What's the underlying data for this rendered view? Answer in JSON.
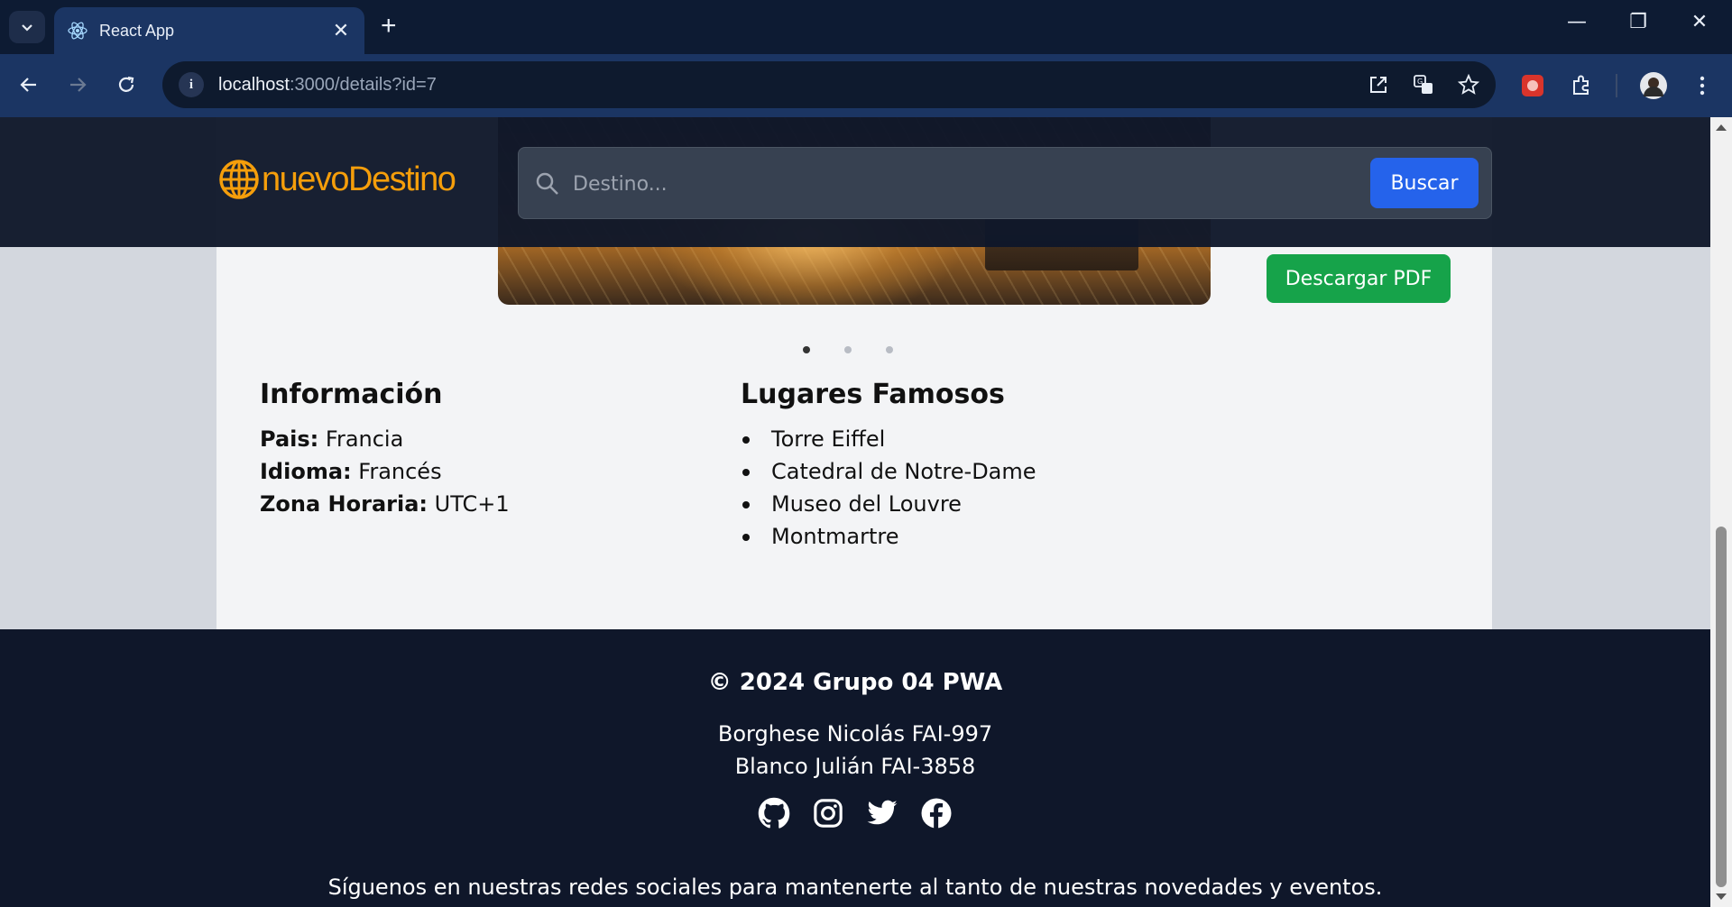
{
  "browser": {
    "tab_title": "React App",
    "url_host": "localhost",
    "url_path": ":3000/details?id=7"
  },
  "header": {
    "logo_text": "nuevoDestino",
    "search_placeholder": "Destino...",
    "search_button": "Buscar"
  },
  "carousel": {
    "slide_count": 3,
    "active_index": 0
  },
  "info": {
    "title": "Información",
    "rows": [
      {
        "label": "Pais:",
        "value": "Francia"
      },
      {
        "label": "Idioma:",
        "value": "Francés"
      },
      {
        "label": "Zona Horaria:",
        "value": "UTC+1"
      }
    ]
  },
  "places": {
    "title": "Lugares Famosos",
    "items": [
      "Torre Eiffel",
      "Catedral de Notre-Dame",
      "Museo del Louvre",
      "Montmartre"
    ]
  },
  "actions": {
    "pdf_button": "Descargar PDF"
  },
  "footer": {
    "copyright": "© 2024 Grupo 04 PWA",
    "members": [
      "Borghese Nicolás FAI-997",
      "Blanco Julián FAI-3858"
    ],
    "social_icons": [
      "github-icon",
      "instagram-icon",
      "twitter-icon",
      "facebook-icon"
    ],
    "tagline": "Síguenos en nuestras redes sociales para mantenerte al tanto de nuestras novedades y eventos."
  },
  "colors": {
    "header_bg": "#0f172a",
    "logo": "#f59e0b",
    "search_button": "#2563eb",
    "pdf_button": "#16a34a"
  }
}
